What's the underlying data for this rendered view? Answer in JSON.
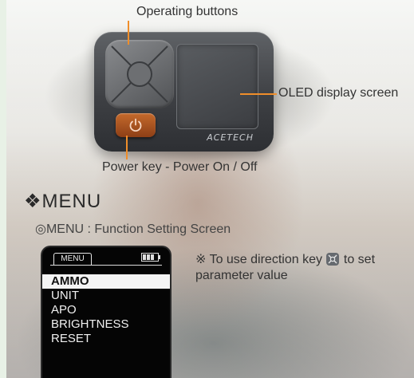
{
  "callouts": {
    "operating_buttons": "Operating buttons",
    "oled_display": "OLED display screen",
    "power_key": "Power key - Power On / Off"
  },
  "device": {
    "brand": "ACETECH",
    "accent_color": "#f08e2a",
    "power_color": "#b5581f"
  },
  "menu_section": {
    "heading": "❖MENU",
    "subheading": "◎MENU : Function Setting Screen",
    "note_prefix": "※ To use direction key",
    "note_suffix": "to set parameter value"
  },
  "screen": {
    "tab_label": "MENU",
    "battery_icon": "battery-icon",
    "items": [
      {
        "label": "AMMO",
        "selected": true
      },
      {
        "label": "UNIT",
        "selected": false
      },
      {
        "label": "APO",
        "selected": false
      },
      {
        "label": "BRIGHTNESS",
        "selected": false
      },
      {
        "label": "RESET",
        "selected": false
      }
    ]
  }
}
